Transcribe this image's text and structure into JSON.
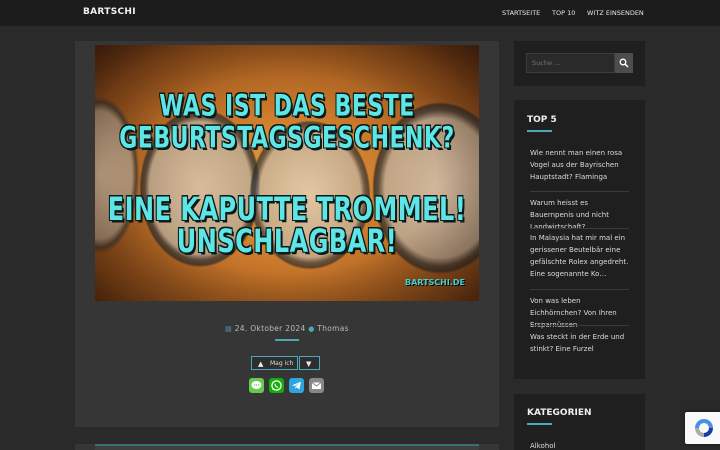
{
  "header": {
    "brand": "BARTSCHI",
    "nav": [
      "STARTSEITE",
      "TOP 10",
      "WITZ EINSENDEN"
    ]
  },
  "post": {
    "image_text": {
      "line1": "WAS IST DAS BESTE",
      "line2": "GEBURTSTAGSGESCHENK?",
      "line3": "EINE KAPUTTE TROMMEL!",
      "line4": "UNSCHLAGBAR!",
      "watermark": "BARTSCHI.DE"
    },
    "date": "24. Oktober 2024",
    "author": "Thomas",
    "like_label": "Mag ich",
    "share_icons": [
      "sms-icon",
      "whatsapp-icon",
      "telegram-icon",
      "email-icon"
    ]
  },
  "sidebar": {
    "search": {
      "placeholder": "Suche …"
    },
    "top": {
      "title": "TOP 5",
      "items": [
        "Wie nennt man einen rosa Vogel aus der Bayrischen Hauptstadt? Flaminga",
        "Warum heisst es Bauernpenis und nicht Landwirtschaft?",
        "In Malaysia hat mir mal ein gerissener Beutelbär eine gefälschte Rolex angedreht. Eine sogenannte Ko…",
        "Von was leben Eichhörnchen? Von Ihren Ersparnüssen",
        "Was steckt in der Erde und stinkt? Eine Furzel"
      ]
    },
    "categories": {
      "title": "KATEGORIEN",
      "items": [
        "Alkohol"
      ]
    }
  },
  "colors": {
    "background": "#2a2a2a",
    "header": "#1c1c1c",
    "card": "#363636",
    "widget": "#1f1f1f",
    "accent": "#4aa8b8",
    "meme_text": "#5ee6e6"
  }
}
